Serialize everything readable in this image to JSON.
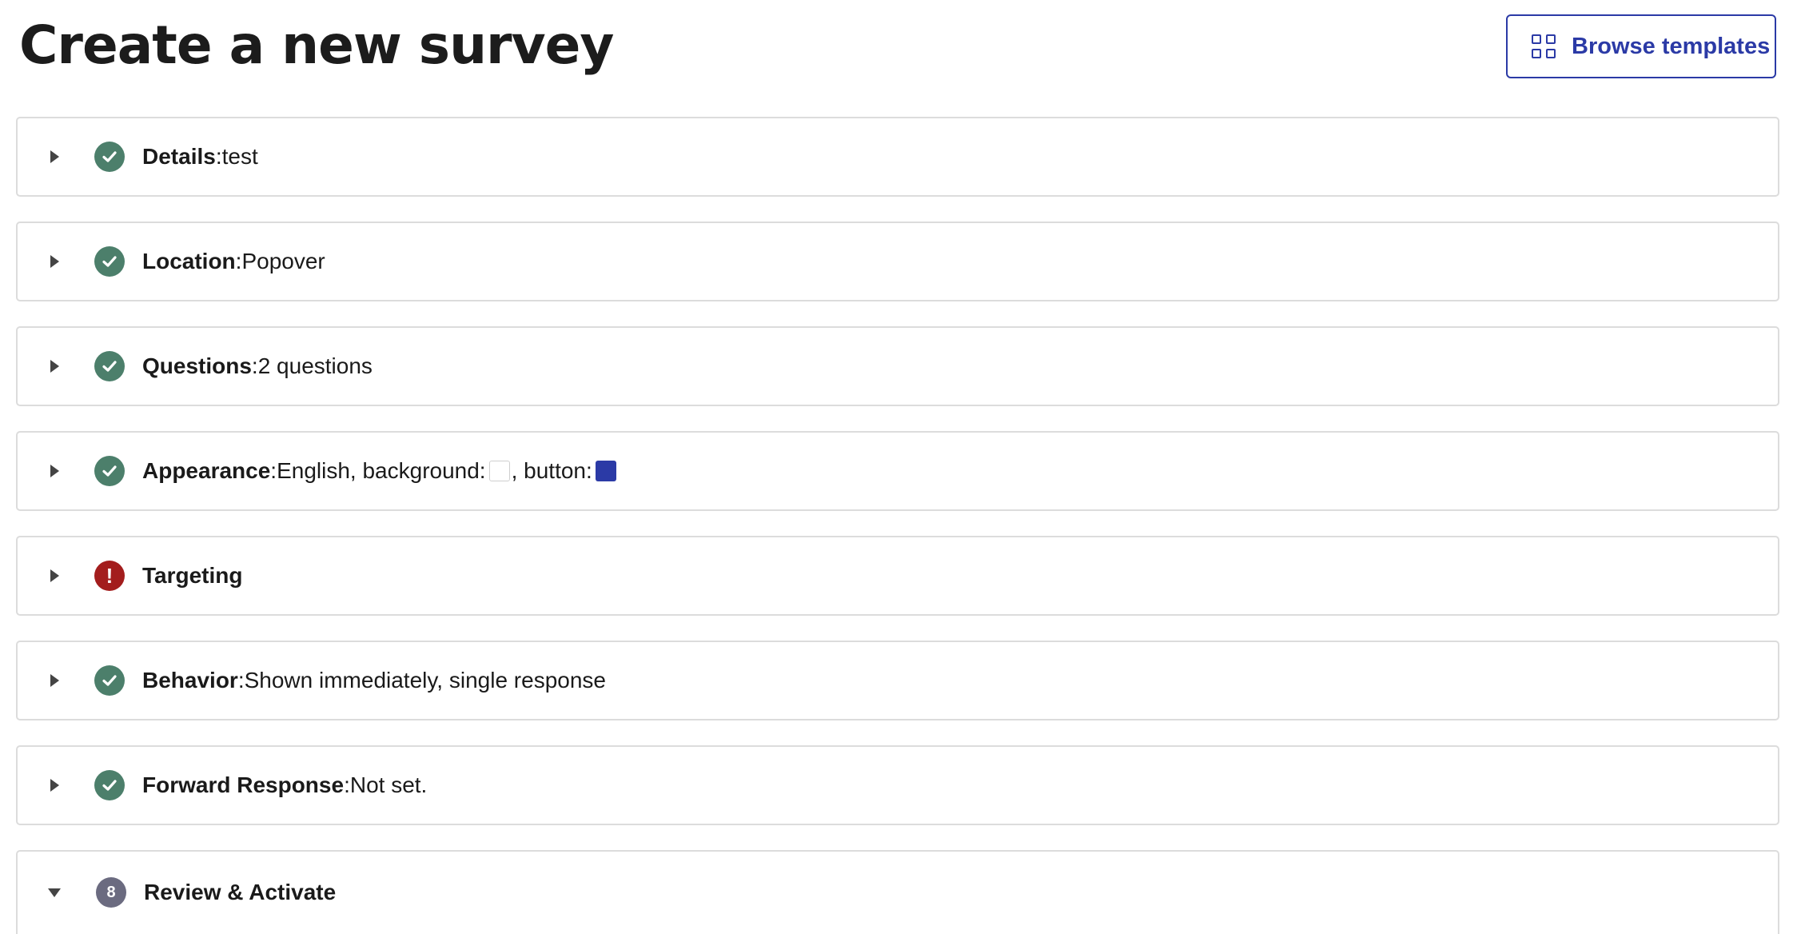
{
  "header": {
    "title": "Create a new survey",
    "browse_templates_label": "Browse templates"
  },
  "colors": {
    "accent": "#2b3aa6",
    "success": "#4c7f6b",
    "error": "#a31d1d",
    "step_badge": "#6b6b80",
    "appearance_background": "#ffffff",
    "appearance_button": "#2b3aa6"
  },
  "sections": [
    {
      "label": "Details",
      "separator": ": ",
      "value": "test",
      "status": "complete",
      "status_icon": "check-circle-icon",
      "expanded": false
    },
    {
      "label": "Location",
      "separator": ": ",
      "value": "Popover",
      "status": "complete",
      "status_icon": "check-circle-icon",
      "expanded": false
    },
    {
      "label": "Questions",
      "separator": ": ",
      "value": "2 questions",
      "status": "complete",
      "status_icon": "check-circle-icon",
      "expanded": false
    },
    {
      "label": "Appearance",
      "separator": ": ",
      "value": "English, background:",
      "value_after_swatch": ", button:",
      "status": "complete",
      "status_icon": "check-circle-icon",
      "expanded": false
    },
    {
      "label": "Targeting",
      "status": "error",
      "status_icon": "exclamation-circle-icon",
      "status_text": "!",
      "expanded": false
    },
    {
      "label": "Behavior",
      "separator": ": ",
      "value": "Shown immediately, single response",
      "status": "complete",
      "status_icon": "check-circle-icon",
      "expanded": false
    },
    {
      "label": "Forward Response",
      "separator": ": ",
      "value": "Not set.",
      "status": "complete",
      "status_icon": "check-circle-icon",
      "expanded": false
    },
    {
      "label": "Review & Activate",
      "status": "pending",
      "status_icon": "step-number-icon",
      "step_number": "8",
      "expanded": true
    }
  ]
}
